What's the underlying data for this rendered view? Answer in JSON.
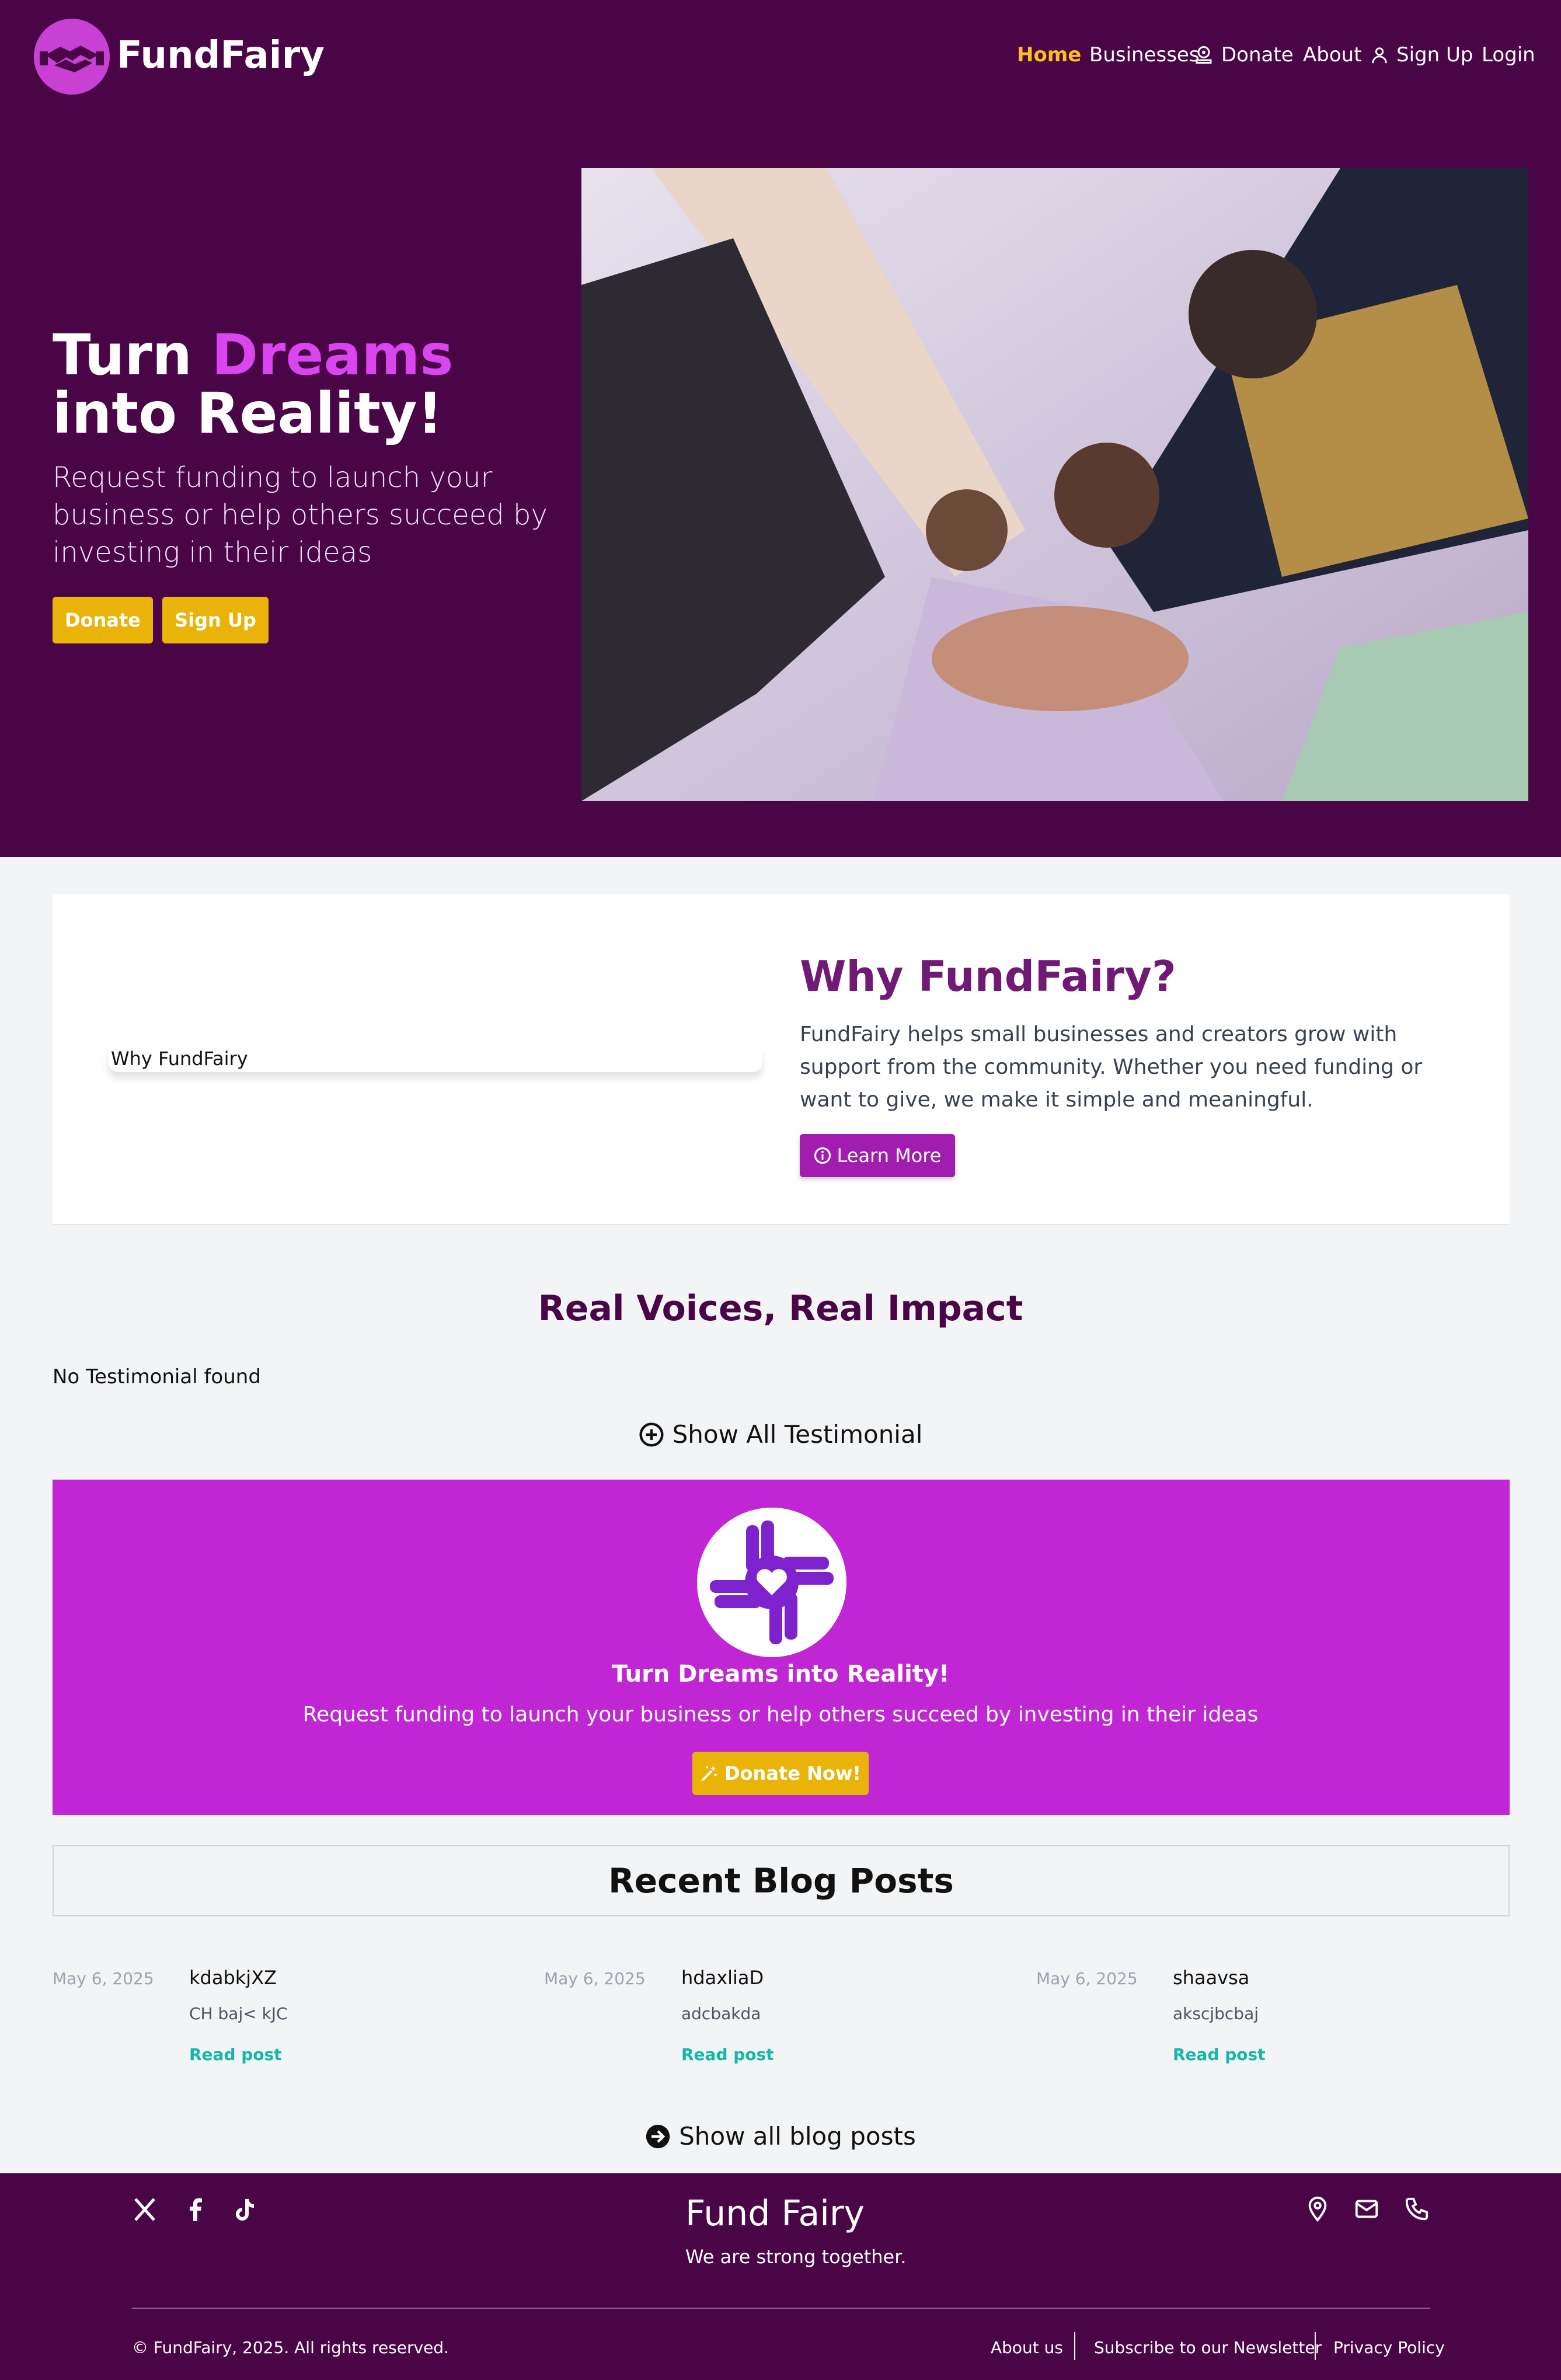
{
  "nav": {
    "brand": "FundFairy",
    "items": [
      {
        "label": "Home",
        "active": true
      },
      {
        "label": "Businesses"
      },
      {
        "label": "Donate",
        "icon": "donate-icon"
      },
      {
        "label": "About"
      },
      {
        "label": "Sign Up",
        "icon": "user-icon"
      },
      {
        "label": "Login"
      }
    ]
  },
  "hero": {
    "title_part1": "Turn ",
    "title_accent": "Dreams",
    "title_part2": " into Reality!",
    "subtitle": "Request funding to launch your business or help others succeed by investing in their ideas",
    "donate_label": "Donate",
    "signup_label": "Sign Up"
  },
  "why": {
    "image_alt": "Why FundFairy",
    "title": "Why FundFairy?",
    "text": "FundFairy helps small businesses and creators grow with support from the community. Whether you need funding or want to give, we make it simple and meaningful.",
    "button_label": "Learn More"
  },
  "testimonials": {
    "title": "Real Voices, Real Impact",
    "empty_text": "No Testimonial found",
    "show_all_label": "Show All Testimonial"
  },
  "cta": {
    "title": "Turn Dreams into Reality!",
    "subtitle": "Request funding to launch your business or help others succeed by investing in their ideas",
    "button_label": "Donate Now!"
  },
  "blog": {
    "title": "Recent Blog Posts",
    "posts": [
      {
        "date": "May 6, 2025",
        "title": "kdabkjXZ",
        "excerpt": "CH baj< kJC",
        "read": "Read post"
      },
      {
        "date": "May 6, 2025",
        "title": "hdaxliaD",
        "excerpt": "adcbakda",
        "read": "Read post"
      },
      {
        "date": "May 6, 2025",
        "title": "shaavsa",
        "excerpt": "akscjbcbaj",
        "read": "Read post"
      }
    ],
    "show_all_label": "Show all blog posts"
  },
  "footer": {
    "brand": "Fund Fairy",
    "tagline": "We are strong together.",
    "copyright": "© FundFairy, 2025. All rights reserved.",
    "links": [
      "About us",
      "Subscribe to our Newsletter",
      "Privacy Policy"
    ],
    "social_icons": [
      "x-icon",
      "facebook-icon",
      "tiktok-icon"
    ],
    "contact_icons": [
      "location-icon",
      "mail-icon",
      "phone-icon"
    ]
  },
  "colors": {
    "primary_dark": "#4a0547",
    "accent_purple": "#c026d3",
    "accent_yellow": "#eab308",
    "active_nav": "#fbbf24",
    "link_teal": "#14b8a6"
  }
}
